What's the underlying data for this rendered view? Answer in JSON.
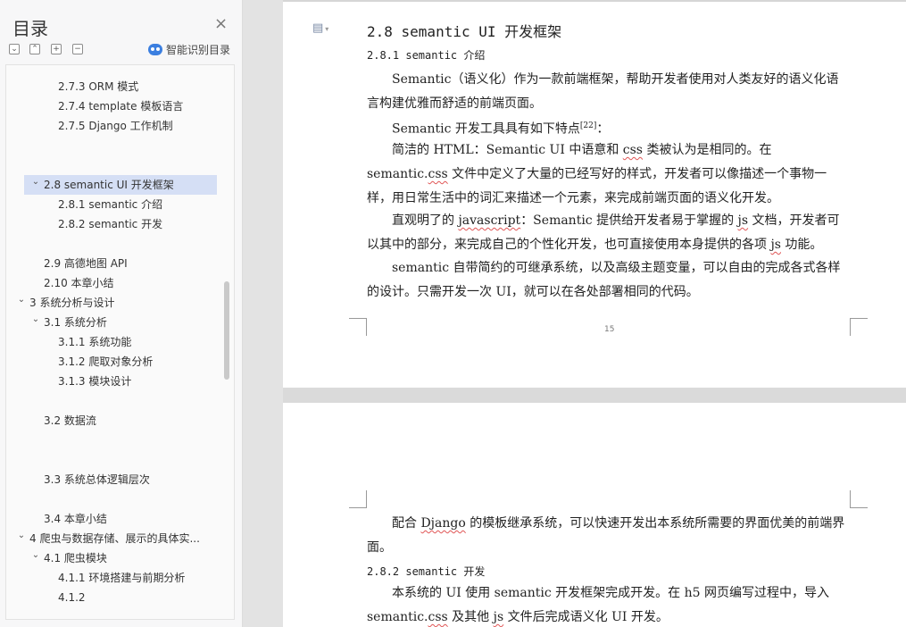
{
  "toc": {
    "title": "目录",
    "close_glyph": "×",
    "toolbar": {
      "collapse_all": "⌄",
      "expand_up": "⌃",
      "plus": "+",
      "minus": "−",
      "smart_label": "智能识别目录"
    },
    "items": [
      {
        "label": "2.7.3 ORM 模式",
        "level": 3
      },
      {
        "label": "2.7.4 template 模板语言",
        "level": 3
      },
      {
        "label": "2.7.5 Django 工作机制",
        "level": 3
      },
      {
        "label": "2.8 semantic UI 开发框架",
        "level": 2,
        "expanded": true,
        "selected": true
      },
      {
        "label": "2.8.1 semantic 介绍",
        "level": 3
      },
      {
        "label": "2.8.2 semantic 开发",
        "level": 3
      },
      {
        "label": "2.9  高德地图 API",
        "level": 2
      },
      {
        "label": "2.10  本章小结",
        "level": 2
      },
      {
        "label": "3  系统分析与设计",
        "level": 1,
        "expanded": true
      },
      {
        "label": "3.1  系统分析",
        "level": 2,
        "expanded": true
      },
      {
        "label": "3.1.1  系统功能",
        "level": 3
      },
      {
        "label": "3.1.2  爬取对象分析",
        "level": 3
      },
      {
        "label": "3.1.3  模块设计",
        "level": 3
      },
      {
        "label": "3.2  数据流",
        "level": 2
      },
      {
        "label": "3.3  系统总体逻辑层次",
        "level": 2
      },
      {
        "label": "3.4  本章小结",
        "level": 2
      },
      {
        "label": "4  爬虫与数据存储、展示的具体实...",
        "level": 1,
        "expanded": true
      },
      {
        "label": "4.1  爬虫模块",
        "level": 2,
        "expanded": true
      },
      {
        "label": "4.1.1  环境搭建与前期分析",
        "level": 3
      },
      {
        "label": "4.1.2",
        "level": 3
      }
    ]
  },
  "document": {
    "page1": {
      "heading": "2.8 semantic UI 开发框架",
      "subheading": "2.8.1 semantic 介绍",
      "p1": "Semantic（语义化）作为一款前端框架，帮助开发者使用对人类友好的语义化语言构建优雅而舒适的前端页面。",
      "p2_text": "Semantic 开发工具具有如下特点",
      "p2_ref": "[22]",
      "p2_end": "：",
      "p3_a": "简洁的 HTML：Semantic UI 中语意和 ",
      "p3_css": "css",
      "p3_b": " 类被认为是相同的。在 semantic.",
      "p3_css2": "css",
      "p3_c": " 文件中定义了大量的已经写好的样式，开发者可以像描述一个事物一样，用日常生活中的词汇来描述一个元素，来完成前端页面的语义化开发。",
      "p4_a": "直观明了的 ",
      "p4_js": "javascript",
      "p4_b": "：Semantic 提供给开发者易于掌握的 ",
      "p4_js2": "js",
      "p4_c": " 文档，开发者可以其中的部分，来完成自己的个性化开发，也可直接使用本身提供的各项 ",
      "p4_js3": "js",
      "p4_d": " 功能。",
      "p5": "semantic 自带简约的可继承系统，以及高级主题变量，可以自由的完成各式各样的设计。只需开发一次 UI，就可以在各处部署相同的代码。",
      "page_number": "15"
    },
    "page2": {
      "p1_a": "配合 ",
      "p1_django": "Django",
      "p1_b": " 的模板继承系统，可以快速开发出本系统所需要的界面优美的前端界面。",
      "subheading": "2.8.2 semantic 开发",
      "p2_a": "本系统的 UI 使用 semantic 开发框架完成开发。在 h5 网页编写过程中，导入 semantic.",
      "p2_css": "css",
      "p2_b": " 及其他 ",
      "p2_js": "js",
      "p2_c": " 文件后完成语义化 UI 开发。"
    },
    "doc_icon": "document-icon"
  }
}
